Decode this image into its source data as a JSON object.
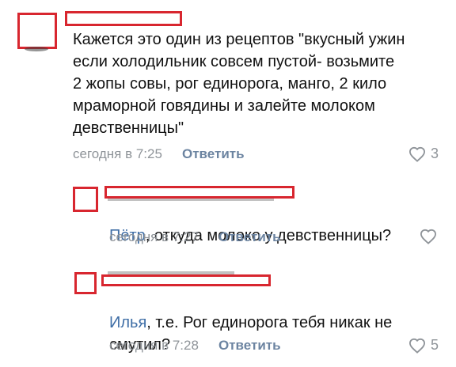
{
  "comments": [
    {
      "text": "Кажется это один из рецептов \"вкусный ужин\nесли холодильник совсем пустой- возьмите\n2 жопы совы, рог единорога, манго, 2 кило\nмраморной говядины и залейте молоком\nдевственницы\"",
      "time": "сегодня в 7:25",
      "reply_label": "Ответить",
      "likes": "3"
    },
    {
      "mention": "Пётр",
      "text": ", откуда молоко у девственницы?",
      "time": "сегодня в 7:27",
      "reply_label": "Ответить",
      "likes": ""
    },
    {
      "mention": "Илья",
      "text": ", т.е. Рог единорога тебя никак не\nсмутил?",
      "time": "сегодня в 7:28",
      "reply_label": "Ответить",
      "likes": "5"
    }
  ],
  "icons": {
    "like": "heart-outline-icon"
  },
  "colors": {
    "redaction": "#d8262f",
    "mention": "#3f6ea6",
    "meta": "#8f9499",
    "reply": "#6c84a1"
  }
}
